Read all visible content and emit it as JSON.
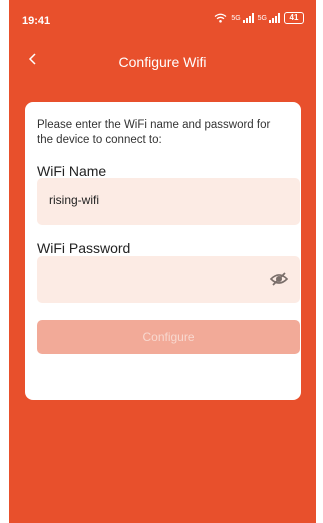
{
  "status_bar": {
    "time": "19:41",
    "network_1": "5G",
    "network_2": "5G",
    "battery": "41"
  },
  "nav": {
    "back_icon": "chevron-left-icon",
    "title": "Configure Wifi"
  },
  "form": {
    "instructions": "Please enter the WiFi name and password for the device to connect to:",
    "wifi_name_label": "WiFi Name",
    "wifi_name_value": "rising-wifi",
    "wifi_password_label": "WiFi Password",
    "wifi_password_value": "",
    "password_visibility_icon": "eye-off-icon",
    "configure_label": "Configure"
  },
  "colors": {
    "background": "#e8502c",
    "field": "#fcebe4",
    "button_disabled": "#f2aa98"
  }
}
